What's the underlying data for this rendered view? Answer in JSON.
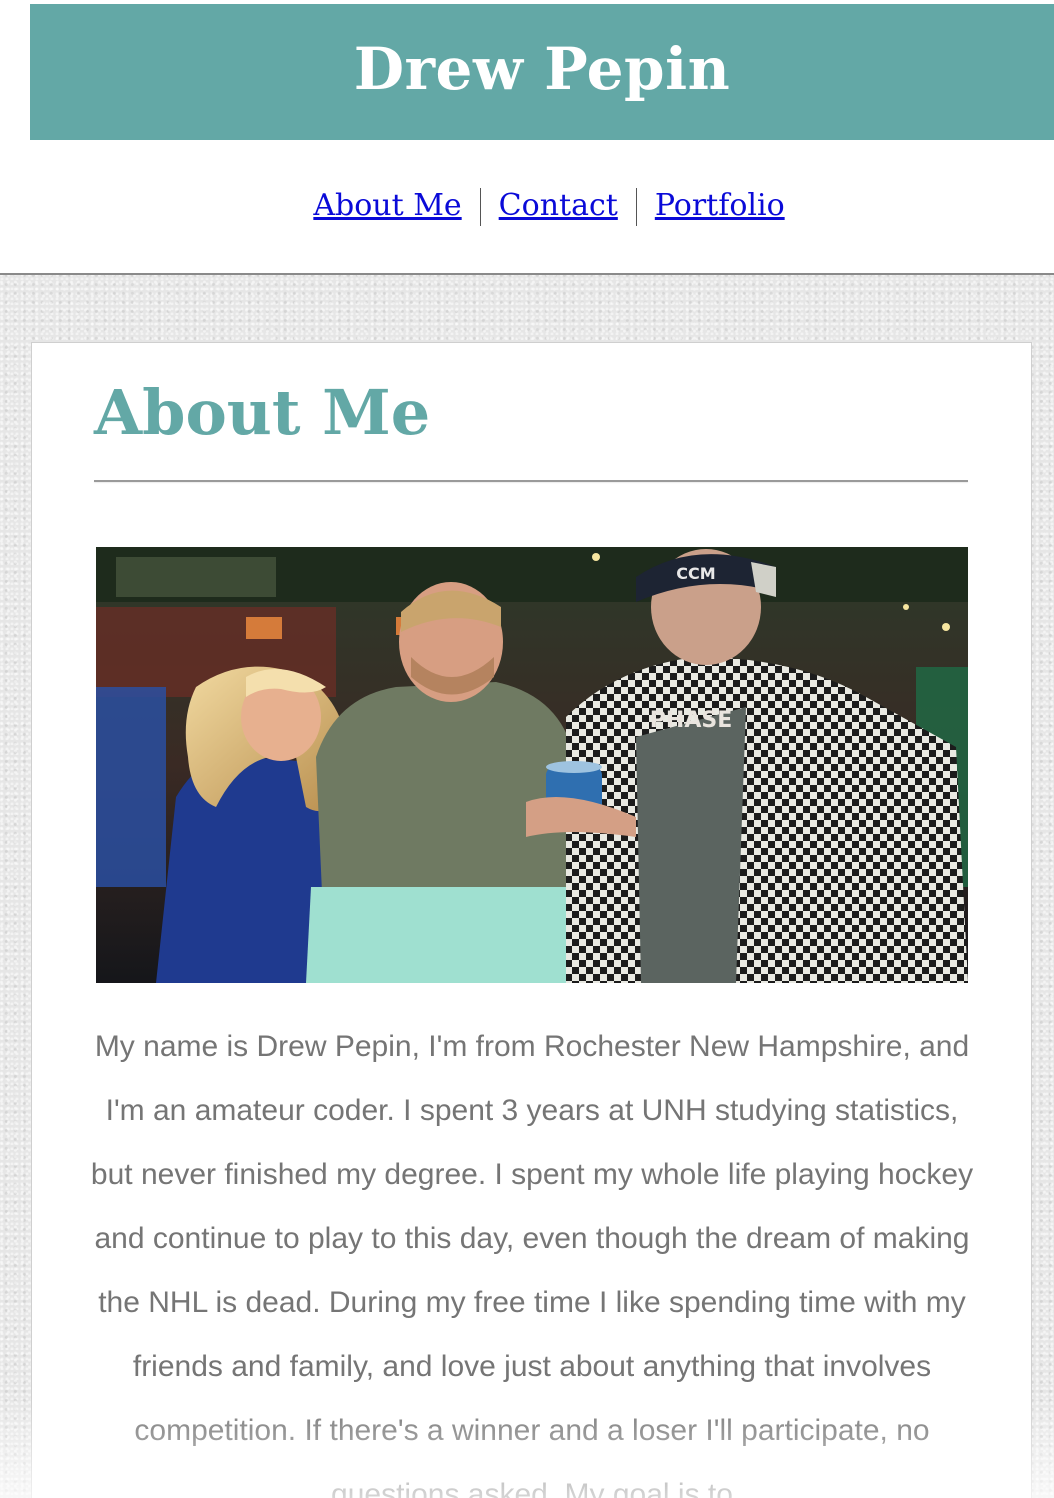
{
  "site": {
    "title": "Drew Pepin"
  },
  "nav": {
    "items": [
      {
        "label": "About Me"
      },
      {
        "label": "Contact"
      },
      {
        "label": "Portfolio"
      }
    ]
  },
  "about": {
    "heading": "About Me",
    "bio": "My name is Drew Pepin, I'm from Rochester New Hampshire, and I'm an amateur coder. I spent 3 years at UNH studying statistics, but never finished my degree. I spent my whole life playing hockey and continue to play to this day, even though the dream of making the NHL is dead. During my free time I like spending time with my friends and family, and love just about anything that involves competition. If there's a winner and a loser I'll participate, no questions asked. My goal is to",
    "photo": {
      "cap_text": "CCM",
      "shirt_text": "PHASE"
    }
  },
  "colors": {
    "accent": "#63a8a6",
    "link": "#0a0ad8",
    "body_text": "#757575"
  }
}
